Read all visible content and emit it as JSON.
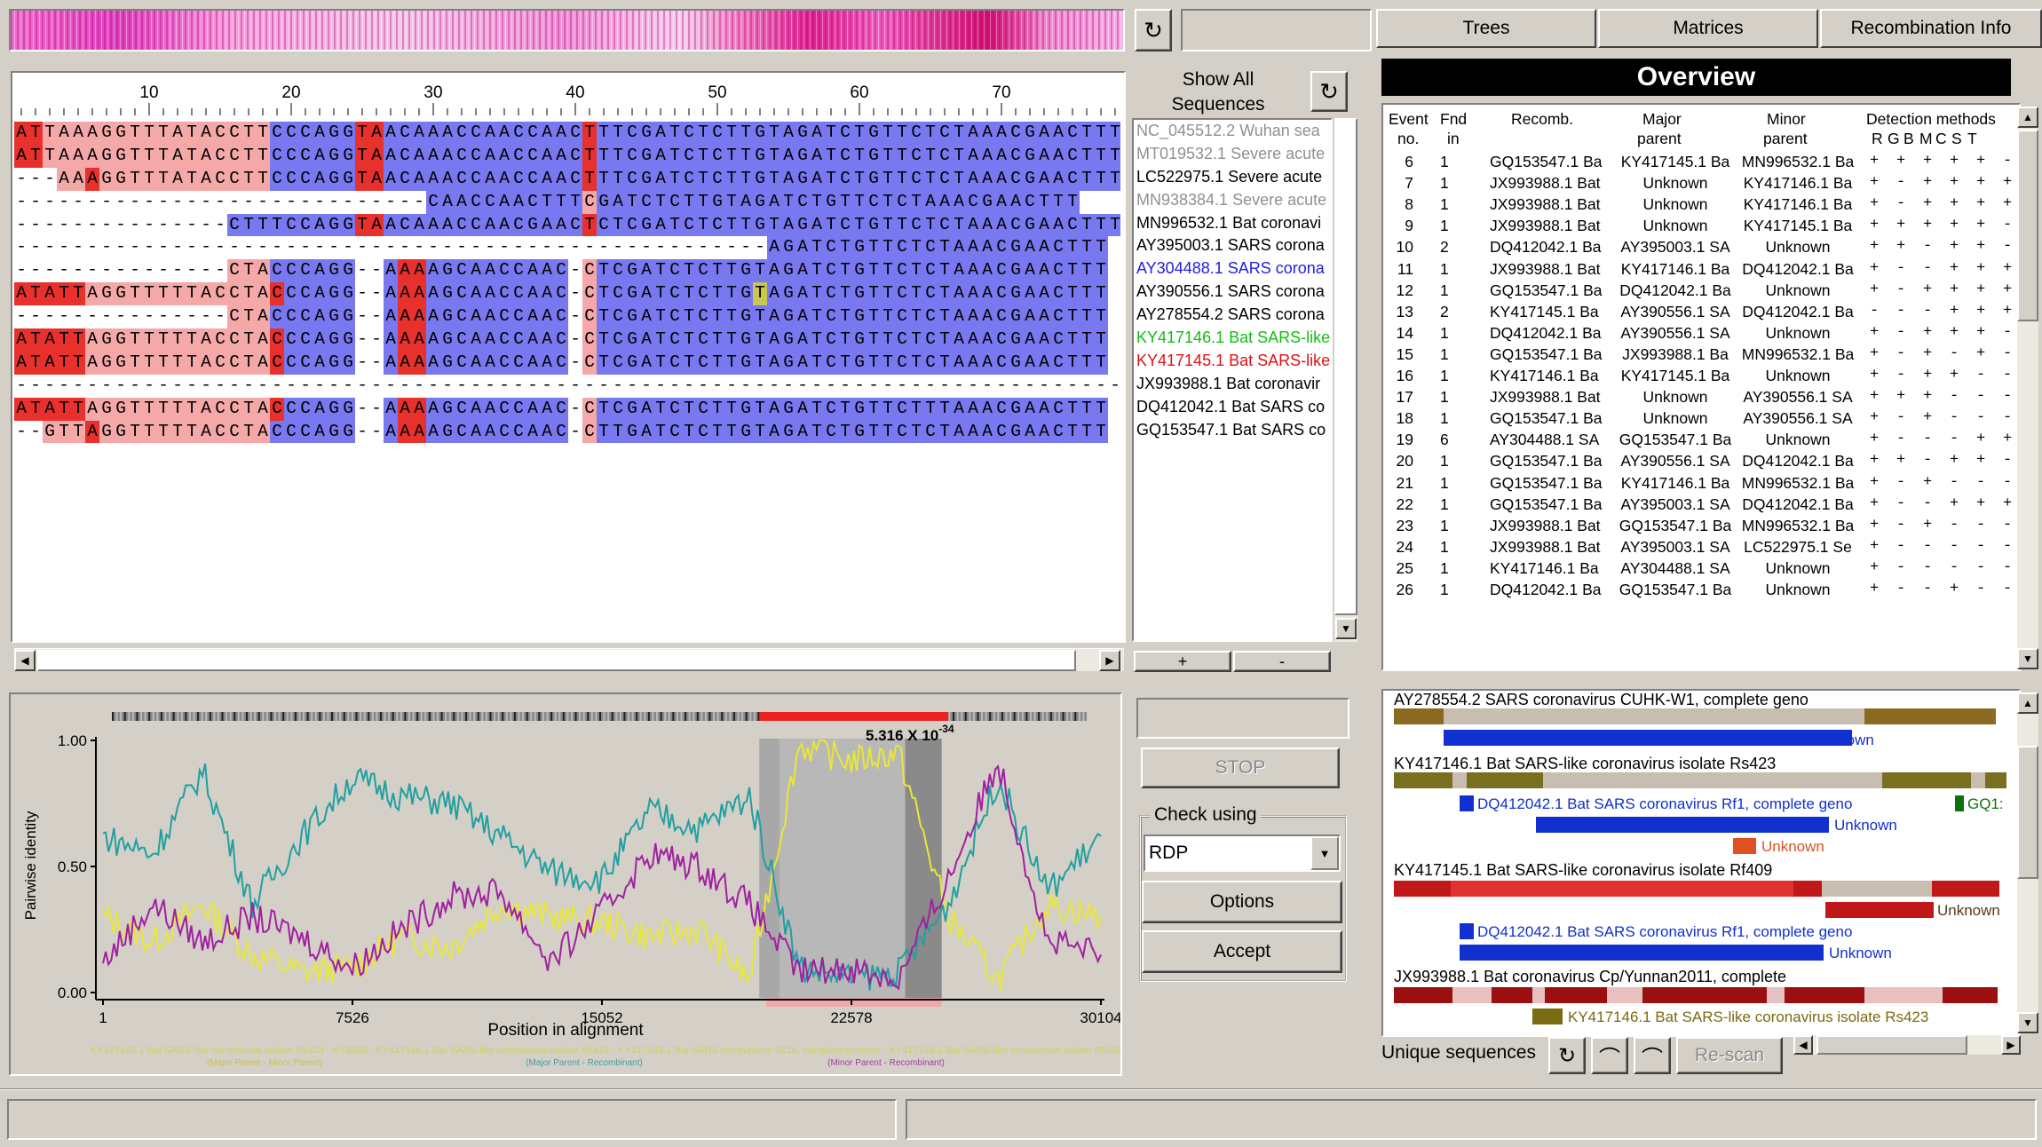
{
  "toolbar": {
    "refresh_icon": "refresh-icon"
  },
  "tabs": [
    {
      "label": "Trees"
    },
    {
      "label": "Matrices"
    },
    {
      "label": "Recombination Info"
    }
  ],
  "overview": {
    "title": "Overview"
  },
  "ruler": {
    "ticks": [
      "10",
      "20",
      "30",
      "40",
      "50",
      "60",
      "70"
    ]
  },
  "show_all": {
    "line1": "Show All",
    "line2": "Sequences"
  },
  "seq_names": [
    {
      "name": "NC_045512.2 Wuhan sea",
      "color": "#909090"
    },
    {
      "name": "MT019532.1 Severe acute",
      "color": "#909090"
    },
    {
      "name": "LC522975.1 Severe acute",
      "color": "#000000"
    },
    {
      "name": "MN938384.1 Severe acute",
      "color": "#909090"
    },
    {
      "name": "MN996532.1 Bat coronavi",
      "color": "#000000"
    },
    {
      "name": "AY395003.1 SARS corona",
      "color": "#000000"
    },
    {
      "name": "AY304488.1 SARS corona",
      "color": "#2020e0"
    },
    {
      "name": "AY390556.1 SARS corona",
      "color": "#000000"
    },
    {
      "name": "AY278554.2 SARS corona",
      "color": "#000000"
    },
    {
      "name": "KY417146.1 Bat SARS-like",
      "color": "#10c010"
    },
    {
      "name": "KY417145.1 Bat SARS-like",
      "color": "#e01010"
    },
    {
      "name": "JX993988.1 Bat coronavir",
      "color": "#000000"
    },
    {
      "name": "DQ412042.1 Bat SARS co",
      "color": "#000000"
    },
    {
      "name": "GQ153547.1 Bat SARS co",
      "color": "#000000"
    }
  ],
  "sequences": [
    "ATTAAAGGTTTATACCTTCCCAGGTAACAAACCAACCAACTTTCGATCTCTTGTAGATCTGTTCTCTAAACGAACTTT",
    "ATTAAAGGTTTATACCTTCCCAGGTAACAAACCAACCAACTTTCGATCTCTTGTAGATCTGTTCTCTAAACGAACTTT",
    "---AAAGGTTTATACCTTCCCAGGTAACAAACCAACCAACTTTCGATCTCTTGTAGATCTGTTCTCTAAACGAACTTT",
    "-----------------------------CAACCAACTTTCGATCTCTTGTAGATCTGTTCTCTAAACGAACTTT",
    "---------------CTTTCCAGGTAACAAACCAACGAACTCTCGATCTCTTGTAGATCTGTTCTCTAAACGAACTTT",
    "-----------------------------------------------------AGATCTGTTCTCTAAACGAACTTT",
    "---------------CTACCCAGG--AAAAGCAACCAAC-CTCGATCTCTTGTAGATCTGTTCTCTAAACGAACTTT",
    "ATATTAGGTTTTTACCTACCCAGG--AAAAGCAACCAAC-CTCGATCTCTTGTAGATCTGTTCTCTAAACGAACTTT",
    "---------------CTACCCAGG--AAAAGCAACCAAC-CTCGATCTCTTGTAGATCTGTTCTCTAAACGAACTTT",
    "ATATTAGGTTTTTACCTACCCAGG--AAAAGCAACCAAC-CTCGATCTCTTGTAGATCTGTTCTCTAAACGAACTTT",
    "ATATTAGGTTTTTACCTACCCAGG--AAAAGCAACCAAC-CTCGATCTCTTGTAGATCTGTTCTCTAAACGAACTTT",
    "------------------------------------------------------------------------------",
    "ATATTAGGTTTTTACCTACCCAGG--AAAAGCAACCAAC-CTCGATCTCTTGTAGATCTGTTCTTTAAACGAACTTT",
    "--GTTAGGTTTTTACCTACCCAGG--AAAAGCAACCAAC-CTTGATCTCTTGTAGATCTGTTCTCTAAACGAACTTT"
  ],
  "events_header": {
    "event": "Event",
    "no": "no.",
    "fnd": "Fnd",
    "in": "in",
    "recomb": "Recomb.",
    "major": "Major",
    "major2": "parent",
    "minor": "Minor",
    "minor2": "parent",
    "detection": "Detection methods",
    "methods": [
      "R",
      "G",
      "B",
      "M",
      "C",
      "S",
      "T"
    ]
  },
  "events": [
    {
      "no": "6",
      "fnd": "1",
      "recomb": "GQ153547.1 Ba",
      "major": "KY417145.1 Ba",
      "minor": "MN996532.1 Ba",
      "det": "+ + + + + - +"
    },
    {
      "no": "7",
      "fnd": "1",
      "recomb": "JX993988.1 Bat",
      "major": "Unknown",
      "minor": "KY417146.1 Ba",
      "det": "+ - + + + + +"
    },
    {
      "no": "8",
      "fnd": "1",
      "recomb": "JX993988.1 Bat",
      "major": "Unknown",
      "minor": "KY417146.1 Ba",
      "det": "+ - + + + + +"
    },
    {
      "no": "9",
      "fnd": "1",
      "recomb": "JX993988.1 Bat",
      "major": "Unknown",
      "minor": "KY417145.1 Ba",
      "det": "+ + + + + - +"
    },
    {
      "no": "10",
      "fnd": "2",
      "recomb": "DQ412042.1 Ba",
      "major": "AY395003.1 SA",
      "minor": "Unknown",
      "det": "+ + - + + - +"
    },
    {
      "no": "11",
      "fnd": "1",
      "recomb": "JX993988.1 Bat",
      "major": "KY417146.1 Ba",
      "minor": "DQ412042.1 Ba",
      "det": "+ - - + + + +"
    },
    {
      "no": "12",
      "fnd": "1",
      "recomb": "GQ153547.1 Ba",
      "major": "DQ412042.1 Ba",
      "minor": "Unknown",
      "det": "+ - + + + + -"
    },
    {
      "no": "13",
      "fnd": "2",
      "recomb": "KY417145.1 Ba",
      "major": "AY390556.1 SA",
      "minor": "DQ412042.1 Ba",
      "det": "- - - + + + +"
    },
    {
      "no": "14",
      "fnd": "1",
      "recomb": "DQ412042.1 Ba",
      "major": "AY390556.1 SA",
      "minor": "Unknown",
      "det": "+ - + + + - -"
    },
    {
      "no": "15",
      "fnd": "1",
      "recomb": "GQ153547.1 Ba",
      "major": "JX993988.1 Ba",
      "minor": "MN996532.1 Ba",
      "det": "+ - + - + - +"
    },
    {
      "no": "16",
      "fnd": "1",
      "recomb": "KY417146.1 Ba",
      "major": "KY417145.1 Ba",
      "minor": "Unknown",
      "det": "+ - + + - - +"
    },
    {
      "no": "17",
      "fnd": "1",
      "recomb": "JX993988.1 Bat",
      "major": "Unknown",
      "minor": "AY390556.1 SA",
      "det": "+ + + - - - -"
    },
    {
      "no": "18",
      "fnd": "1",
      "recomb": "GQ153547.1 Ba",
      "major": "Unknown",
      "minor": "AY390556.1 SA",
      "det": "+ - + - - - -"
    },
    {
      "no": "19",
      "fnd": "6",
      "recomb": "AY304488.1 SA",
      "major": "GQ153547.1 Ba",
      "minor": "Unknown",
      "det": "+ - - - + + +"
    },
    {
      "no": "20",
      "fnd": "1",
      "recomb": "GQ153547.1 Ba",
      "major": "AY390556.1 SA",
      "minor": "DQ412042.1 Ba",
      "det": "+ + - + + - -"
    },
    {
      "no": "21",
      "fnd": "1",
      "recomb": "GQ153547.1 Ba",
      "major": "KY417146.1 Ba",
      "minor": "MN996532.1 Ba",
      "det": "+ - + - - - +"
    },
    {
      "no": "22",
      "fnd": "1",
      "recomb": "GQ153547.1 Ba",
      "major": "AY395003.1 SA",
      "minor": "DQ412042.1 Ba",
      "det": "+ - - + + + +"
    },
    {
      "no": "23",
      "fnd": "1",
      "recomb": "JX993988.1 Bat",
      "major": "GQ153547.1 Ba",
      "minor": "MN996532.1 Ba",
      "det": "+ - + - - - +"
    },
    {
      "no": "24",
      "fnd": "1",
      "recomb": "JX993988.1 Bat",
      "major": "AY395003.1 SA",
      "minor": "LC522975.1 Se",
      "det": "+ - - - - - -"
    },
    {
      "no": "25",
      "fnd": "1",
      "recomb": "KY417146.1 Ba",
      "major": "AY304488.1 SA",
      "minor": "Unknown",
      "det": "+ - - - - - -"
    },
    {
      "no": "26",
      "fnd": "1",
      "recomb": "DQ412042.1 Ba",
      "major": "GQ153547.1 Ba",
      "minor": "Unknown",
      "det": "+ - - + - - -"
    }
  ],
  "plot": {
    "ylabel": "Pairwise identity",
    "xlabel": "Position in alignment",
    "yticks": [
      "1.00",
      "0.50",
      "0.00"
    ],
    "xticks": [
      "1",
      "7526",
      "15052",
      "22578",
      "30104"
    ],
    "pvalue": "5.316 X 10",
    "pexp": "-34",
    "legend1": "KY417146.1 Bat SARS-like coronavirus isolate Rs423 - KY3888 - KY417146.1 Bat SARS-like coronavirus isolate Rs423 - KY417145.1 Bat SARS coronavirus SZ16, complete genome - KY417145.1 Bat SARS-like coronavirus isolate Rf409",
    "legend2a": "(Major Parent - Minor Parent)",
    "legend2b": "(Major Parent - Recombinant)",
    "legend2c": "(Minor Parent - Recombinant)"
  },
  "controls": {
    "stop": "STOP",
    "check_using": "Check using",
    "method": "RDP",
    "options": "Options",
    "accept": "Accept",
    "plus": "+",
    "minus": "-"
  },
  "rec_panel": [
    {
      "label": "AY278554.2 SARS coronavirus CUHK-W1, complete geno"
    },
    {
      "label": "Unknown"
    },
    {
      "label": "KY417146.1 Bat SARS-like coronavirus isolate Rs423"
    },
    {
      "label": "DQ412042.1 Bat SARS coronavirus Rf1, complete geno"
    },
    {
      "label": "GQ1:"
    },
    {
      "label": "Unknown"
    },
    {
      "label": "Unknown"
    },
    {
      "label": "KY417145.1 Bat SARS-like coronavirus isolate Rf409"
    },
    {
      "label": "Unknown"
    },
    {
      "label": "DQ412042.1 Bat SARS coronavirus Rf1, complete geno"
    },
    {
      "label": "Unknown"
    },
    {
      "label": "JX993988.1 Bat coronavirus Cp/Yunnan2011, complete"
    },
    {
      "label": "KY417146.1 Bat SARS-like coronavirus isolate Rs423"
    }
  ],
  "bottom": {
    "unique": "Unique sequences",
    "rescan": "Re-scan"
  },
  "chart_data": {
    "type": "line",
    "title": "",
    "xlabel": "Position in alignment",
    "ylabel": "Pairwise identity",
    "xlim": [
      1,
      30104
    ],
    "ylim": [
      0,
      1
    ],
    "x": [
      1,
      1500,
      3000,
      4500,
      6000,
      7526,
      9000,
      10500,
      12000,
      13500,
      15052,
      16500,
      18000,
      19500,
      21000,
      22578,
      24000,
      25500,
      27000,
      28500,
      30104
    ],
    "series": [
      {
        "color": "#e8e838",
        "values": [
          0.3,
          0.2,
          0.35,
          0.15,
          0.08,
          0.1,
          0.22,
          0.18,
          0.35,
          0.3,
          0.28,
          0.22,
          0.25,
          0.05,
          0.98,
          0.92,
          0.95,
          0.3,
          0.05,
          0.35,
          0.3
        ]
      },
      {
        "color": "#20a0a0",
        "values": [
          0.62,
          0.55,
          0.88,
          0.35,
          0.62,
          0.85,
          0.78,
          0.75,
          0.62,
          0.48,
          0.45,
          0.72,
          0.65,
          0.78,
          0.1,
          0.06,
          0.08,
          0.35,
          0.85,
          0.4,
          0.62
        ]
      },
      {
        "color": "#a020a0",
        "values": [
          0.12,
          0.35,
          0.2,
          0.3,
          0.22,
          0.1,
          0.25,
          0.38,
          0.4,
          0.12,
          0.32,
          0.55,
          0.5,
          0.35,
          0.08,
          0.1,
          0.05,
          0.45,
          0.92,
          0.2,
          0.15
        ]
      }
    ]
  }
}
